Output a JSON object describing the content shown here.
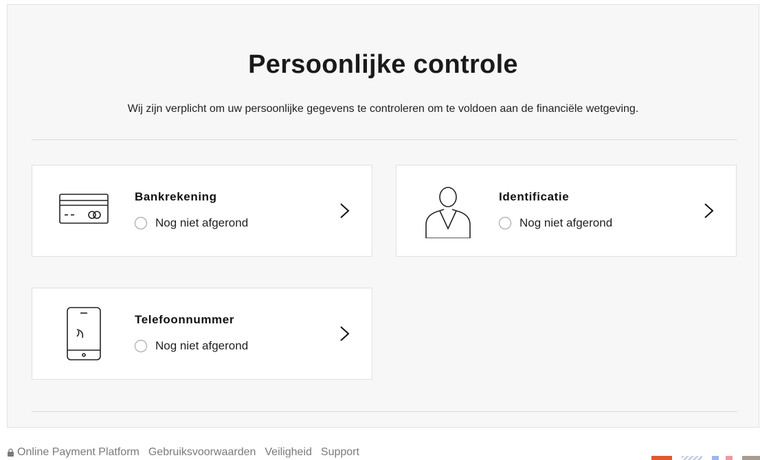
{
  "page": {
    "title": "Persoonlijke controle",
    "subtitle": "Wij zijn verplicht om uw persoonlijke gegevens te controleren om te voldoen aan de financiële wetgeving."
  },
  "cards": [
    {
      "title": "Bankrekening",
      "status": "Nog niet afgerond",
      "icon": "credit-card-icon"
    },
    {
      "title": "Identificatie",
      "status": "Nog niet afgerond",
      "icon": "person-icon"
    },
    {
      "title": "Telefoonnummer",
      "status": "Nog niet afgerond",
      "icon": "phone-icon"
    }
  ],
  "footer": {
    "links": [
      "Online Payment Platform",
      "Gebruiksvoorwaarden",
      "Veiligheid",
      "Support"
    ]
  },
  "languages": [
    {
      "code": "nl",
      "icon": "flag-netherlands-icon"
    },
    {
      "code": "en",
      "icon": "flag-uk-icon"
    },
    {
      "code": "fr",
      "icon": "flag-france-icon"
    },
    {
      "code": "de",
      "icon": "flag-germany-icon"
    }
  ],
  "colors": {
    "panel_bg": "#f7f7f7",
    "card_bg": "#ffffff",
    "text": "#111111",
    "muted": "#7a7a7a"
  }
}
